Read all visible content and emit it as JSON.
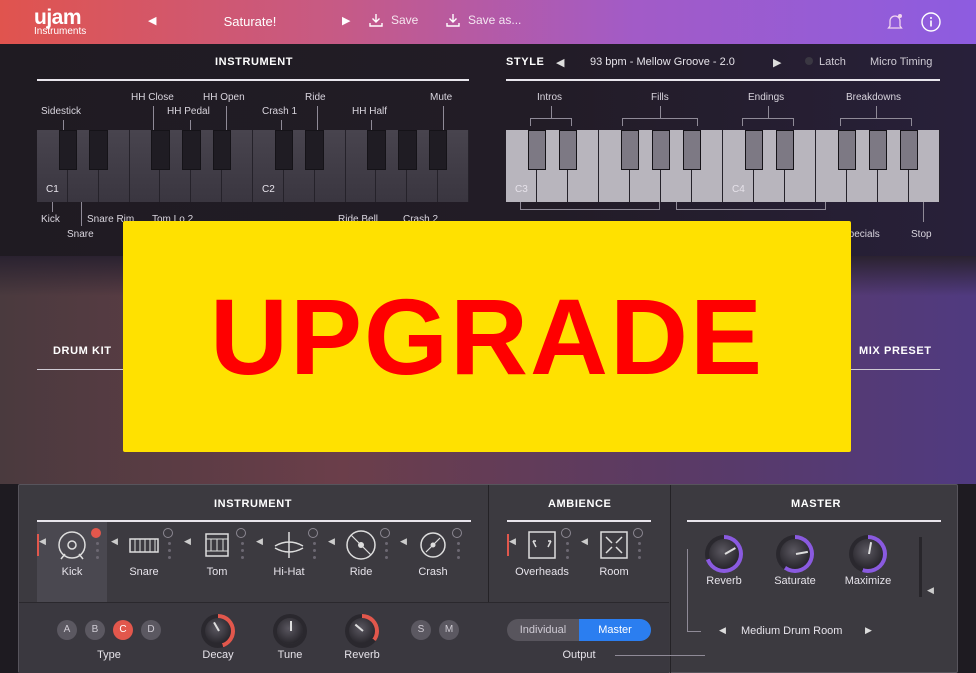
{
  "app": {
    "logo_line1": "ujam",
    "logo_line2": "Instruments",
    "preset_name": "Saturate!",
    "save_label": "Save",
    "save_as_label": "Save as..."
  },
  "instrument_section": {
    "title": "INSTRUMENT",
    "top_labels": [
      "HH Close",
      "HH Open",
      "Sidestick",
      "HH Pedal",
      "Crash 1",
      "Ride",
      "HH Half",
      "Mute"
    ],
    "octave_labels": [
      "C1",
      "C2"
    ],
    "bottom_labels": [
      "Kick",
      "Snare Rim",
      "Snare",
      "Tom Lo 2",
      "Ride Bell",
      "Crash 2"
    ]
  },
  "style_section": {
    "title": "STYLE",
    "style_name": "93 bpm - Mellow Groove - 2.0",
    "latch_label": "Latch",
    "micro_timing_label": "Micro Timing",
    "group_labels": [
      "Intros",
      "Fills",
      "Endings",
      "Breakdowns"
    ],
    "octave_labels": [
      "C3",
      "C4"
    ],
    "bottom_labels": [
      "Specials",
      "Stop"
    ]
  },
  "middle": {
    "drum_kit_label": "DRUM KIT",
    "mix_preset_label": "MIX PRESET"
  },
  "upgrade_banner": {
    "text": "UPGRADE"
  },
  "mixer": {
    "instrument_title": "INSTRUMENT",
    "ambience_title": "AMBIENCE",
    "master_title": "MASTER",
    "instruments": [
      "Kick",
      "Snare",
      "Tom",
      "Hi-Hat",
      "Ride",
      "Crash"
    ],
    "ambience": [
      "Overheads",
      "Room"
    ],
    "master_knobs": [
      "Reverb",
      "Saturate",
      "Maximize"
    ],
    "room_preset": "Medium Drum Room",
    "type_buttons": [
      "A",
      "B",
      "C",
      "D"
    ],
    "type_selected": "C",
    "type_label": "Type",
    "decay_label": "Decay",
    "tune_label": "Tune",
    "reverb_label": "Reverb",
    "solo_label": "S",
    "mute_label": "M",
    "output_options": [
      "Individual",
      "Master"
    ],
    "output_selected": "Master",
    "output_label": "Output"
  },
  "colors": {
    "accent_red": "#e2574c",
    "accent_blue": "#2b7ef0",
    "knob_ring_purple": "#8a5ae0",
    "upgrade_bg": "#ffe100",
    "upgrade_text": "#ff0000"
  }
}
